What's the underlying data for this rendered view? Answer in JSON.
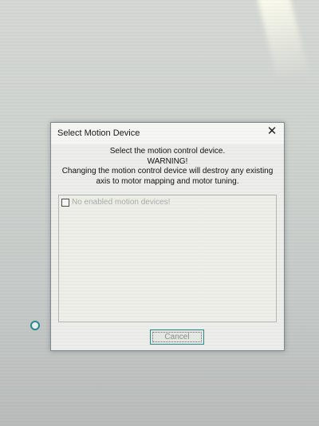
{
  "dialog": {
    "title": "Select Motion Device",
    "close_glyph": "✕",
    "message": {
      "line1": "Select the motion control device.",
      "line2": "WARNING!",
      "line3": "Changing the motion control device will destroy any existing",
      "line4": "axis to motor mapping and motor tuning."
    },
    "device_list": {
      "items": [
        {
          "label": "No enabled motion devices!",
          "checked": false,
          "enabled": false
        }
      ]
    },
    "cancel_label": "Cancel"
  },
  "icons": {
    "close": "close-icon",
    "desktop_indicator": "circle-icon"
  },
  "colors": {
    "focus_accent": "#2a8a8f",
    "dialog_background": "#ededeb",
    "disabled_text": "#a9aca8"
  }
}
